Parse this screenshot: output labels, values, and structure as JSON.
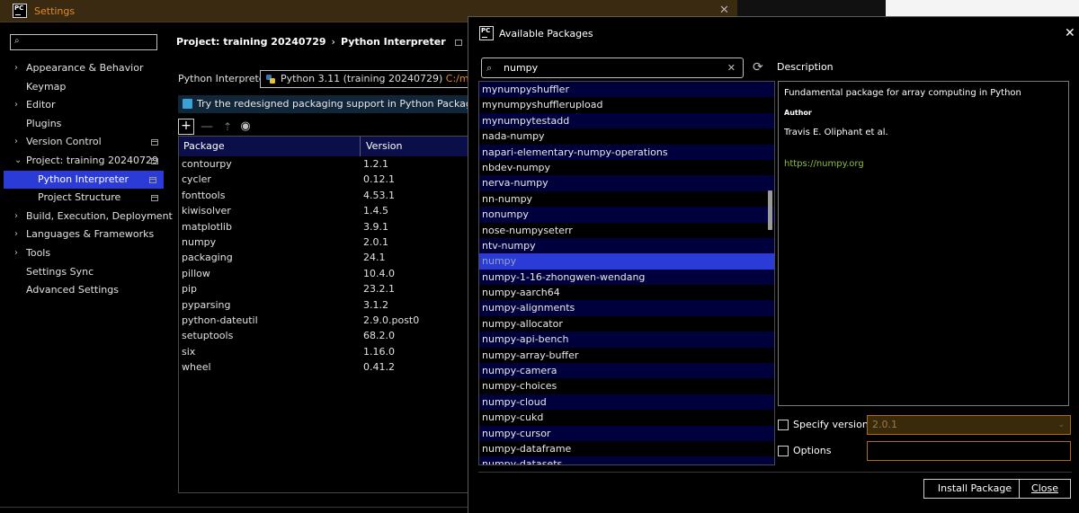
{
  "settings": {
    "title": "Settings",
    "close_glyph": "✕",
    "search": {
      "value": ""
    },
    "nav": [
      {
        "arrow": "›",
        "label": "Appearance & Behavior"
      },
      {
        "arrow": "",
        "label": "Keymap"
      },
      {
        "arrow": "›",
        "label": "Editor"
      },
      {
        "arrow": "",
        "label": "Plugins"
      },
      {
        "arrow": "›",
        "label": "Version Control"
      },
      {
        "arrow": "⌄",
        "label": "Project: training 20240729"
      },
      {
        "arrow": "",
        "label": "Python Interpreter"
      },
      {
        "arrow": "",
        "label": "Project Structure"
      },
      {
        "arrow": "›",
        "label": "Build, Execution, Deployment"
      },
      {
        "arrow": "›",
        "label": "Languages & Frameworks"
      },
      {
        "arrow": "›",
        "label": "Tools"
      },
      {
        "arrow": "",
        "label": "Settings Sync"
      },
      {
        "arrow": "",
        "label": "Advanced Settings"
      }
    ],
    "breadcrumb": {
      "project": "Project: training 20240729",
      "sep": "›",
      "page": "Python Interpreter"
    },
    "interpreter": {
      "label": "Python Interpreter:",
      "name": "Python 3.11 (training 20240729)",
      "path": "C:/mypython"
    },
    "banner": "Try the redesigned packaging support in Python Packages tool window",
    "toolbar": {
      "add": "+",
      "remove": "—",
      "upgrade": "⇡",
      "eye": "◉"
    },
    "table": {
      "headers": [
        "Package",
        "Version"
      ],
      "rows": [
        [
          "contourpy",
          "1.2.1"
        ],
        [
          "cycler",
          "0.12.1"
        ],
        [
          "fonttools",
          "4.53.1"
        ],
        [
          "kiwisolver",
          "1.4.5"
        ],
        [
          "matplotlib",
          "3.9.1"
        ],
        [
          "numpy",
          "2.0.1"
        ],
        [
          "packaging",
          "24.1"
        ],
        [
          "pillow",
          "10.4.0"
        ],
        [
          "pip",
          "23.2.1"
        ],
        [
          "pyparsing",
          "3.1.2"
        ],
        [
          "python-dateutil",
          "2.9.0.post0"
        ],
        [
          "setuptools",
          "68.2.0"
        ],
        [
          "six",
          "1.16.0"
        ],
        [
          "wheel",
          "0.41.2"
        ]
      ]
    }
  },
  "dialog": {
    "title": "Available Packages",
    "close_glyph": "✕",
    "search": {
      "value": "numpy",
      "clear": "✕"
    },
    "refresh_glyph": "⟳",
    "packages": [
      "mynumpyshuffler",
      "mynumpyshufflerupload",
      "mynumpytestadd",
      "nada-numpy",
      "napari-elementary-numpy-operations",
      "nbdev-numpy",
      "nerva-numpy",
      "nn-numpy",
      "nonumpy",
      "nose-numpyseterr",
      "ntv-numpy",
      "numpy",
      "numpy-1-16-zhongwen-wendang",
      "numpy-aarch64",
      "numpy-alignments",
      "numpy-allocator",
      "numpy-api-bench",
      "numpy-array-buffer",
      "numpy-camera",
      "numpy-choices",
      "numpy-cloud",
      "numpy-cukd",
      "numpy-cursor",
      "numpy-dataframe",
      "numpy-datasets"
    ],
    "selected_package": "numpy",
    "description": {
      "label": "Description",
      "summary": "Fundamental package for array computing in Python",
      "author_heading": "Author",
      "author": "Travis E. Oliphant et al.",
      "link": "https://numpy.org"
    },
    "specify_version": {
      "label": "Specify version",
      "value": "2.0.1",
      "checked": false
    },
    "options": {
      "label": "Options",
      "value": "",
      "checked": false
    },
    "buttons": {
      "install": "Install Package",
      "close": "Close"
    }
  },
  "colors": {
    "selection": "#2a3bd6",
    "accent_orange": "#e08a2a",
    "link_green": "#8dbf3a",
    "row_alt": "#00003c"
  }
}
